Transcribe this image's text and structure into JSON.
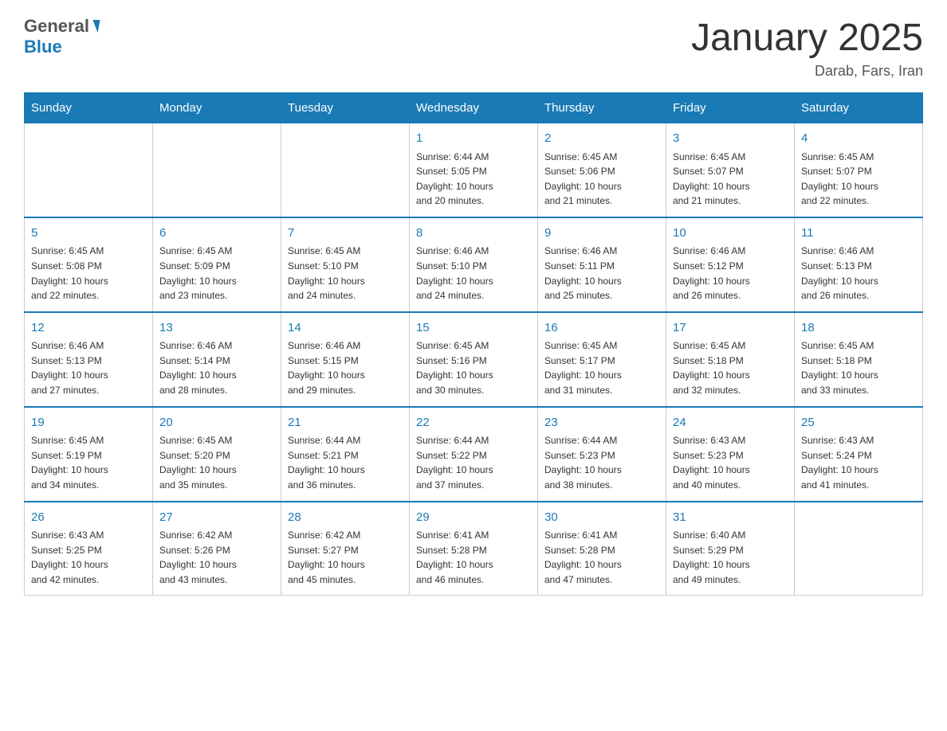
{
  "header": {
    "title": "January 2025",
    "subtitle": "Darab, Fars, Iran",
    "logo_general": "General",
    "logo_blue": "Blue"
  },
  "days_of_week": [
    "Sunday",
    "Monday",
    "Tuesday",
    "Wednesday",
    "Thursday",
    "Friday",
    "Saturday"
  ],
  "weeks": [
    [
      {
        "num": "",
        "info": ""
      },
      {
        "num": "",
        "info": ""
      },
      {
        "num": "",
        "info": ""
      },
      {
        "num": "1",
        "info": "Sunrise: 6:44 AM\nSunset: 5:05 PM\nDaylight: 10 hours\nand 20 minutes."
      },
      {
        "num": "2",
        "info": "Sunrise: 6:45 AM\nSunset: 5:06 PM\nDaylight: 10 hours\nand 21 minutes."
      },
      {
        "num": "3",
        "info": "Sunrise: 6:45 AM\nSunset: 5:07 PM\nDaylight: 10 hours\nand 21 minutes."
      },
      {
        "num": "4",
        "info": "Sunrise: 6:45 AM\nSunset: 5:07 PM\nDaylight: 10 hours\nand 22 minutes."
      }
    ],
    [
      {
        "num": "5",
        "info": "Sunrise: 6:45 AM\nSunset: 5:08 PM\nDaylight: 10 hours\nand 22 minutes."
      },
      {
        "num": "6",
        "info": "Sunrise: 6:45 AM\nSunset: 5:09 PM\nDaylight: 10 hours\nand 23 minutes."
      },
      {
        "num": "7",
        "info": "Sunrise: 6:45 AM\nSunset: 5:10 PM\nDaylight: 10 hours\nand 24 minutes."
      },
      {
        "num": "8",
        "info": "Sunrise: 6:46 AM\nSunset: 5:10 PM\nDaylight: 10 hours\nand 24 minutes."
      },
      {
        "num": "9",
        "info": "Sunrise: 6:46 AM\nSunset: 5:11 PM\nDaylight: 10 hours\nand 25 minutes."
      },
      {
        "num": "10",
        "info": "Sunrise: 6:46 AM\nSunset: 5:12 PM\nDaylight: 10 hours\nand 26 minutes."
      },
      {
        "num": "11",
        "info": "Sunrise: 6:46 AM\nSunset: 5:13 PM\nDaylight: 10 hours\nand 26 minutes."
      }
    ],
    [
      {
        "num": "12",
        "info": "Sunrise: 6:46 AM\nSunset: 5:13 PM\nDaylight: 10 hours\nand 27 minutes."
      },
      {
        "num": "13",
        "info": "Sunrise: 6:46 AM\nSunset: 5:14 PM\nDaylight: 10 hours\nand 28 minutes."
      },
      {
        "num": "14",
        "info": "Sunrise: 6:46 AM\nSunset: 5:15 PM\nDaylight: 10 hours\nand 29 minutes."
      },
      {
        "num": "15",
        "info": "Sunrise: 6:45 AM\nSunset: 5:16 PM\nDaylight: 10 hours\nand 30 minutes."
      },
      {
        "num": "16",
        "info": "Sunrise: 6:45 AM\nSunset: 5:17 PM\nDaylight: 10 hours\nand 31 minutes."
      },
      {
        "num": "17",
        "info": "Sunrise: 6:45 AM\nSunset: 5:18 PM\nDaylight: 10 hours\nand 32 minutes."
      },
      {
        "num": "18",
        "info": "Sunrise: 6:45 AM\nSunset: 5:18 PM\nDaylight: 10 hours\nand 33 minutes."
      }
    ],
    [
      {
        "num": "19",
        "info": "Sunrise: 6:45 AM\nSunset: 5:19 PM\nDaylight: 10 hours\nand 34 minutes."
      },
      {
        "num": "20",
        "info": "Sunrise: 6:45 AM\nSunset: 5:20 PM\nDaylight: 10 hours\nand 35 minutes."
      },
      {
        "num": "21",
        "info": "Sunrise: 6:44 AM\nSunset: 5:21 PM\nDaylight: 10 hours\nand 36 minutes."
      },
      {
        "num": "22",
        "info": "Sunrise: 6:44 AM\nSunset: 5:22 PM\nDaylight: 10 hours\nand 37 minutes."
      },
      {
        "num": "23",
        "info": "Sunrise: 6:44 AM\nSunset: 5:23 PM\nDaylight: 10 hours\nand 38 minutes."
      },
      {
        "num": "24",
        "info": "Sunrise: 6:43 AM\nSunset: 5:23 PM\nDaylight: 10 hours\nand 40 minutes."
      },
      {
        "num": "25",
        "info": "Sunrise: 6:43 AM\nSunset: 5:24 PM\nDaylight: 10 hours\nand 41 minutes."
      }
    ],
    [
      {
        "num": "26",
        "info": "Sunrise: 6:43 AM\nSunset: 5:25 PM\nDaylight: 10 hours\nand 42 minutes."
      },
      {
        "num": "27",
        "info": "Sunrise: 6:42 AM\nSunset: 5:26 PM\nDaylight: 10 hours\nand 43 minutes."
      },
      {
        "num": "28",
        "info": "Sunrise: 6:42 AM\nSunset: 5:27 PM\nDaylight: 10 hours\nand 45 minutes."
      },
      {
        "num": "29",
        "info": "Sunrise: 6:41 AM\nSunset: 5:28 PM\nDaylight: 10 hours\nand 46 minutes."
      },
      {
        "num": "30",
        "info": "Sunrise: 6:41 AM\nSunset: 5:28 PM\nDaylight: 10 hours\nand 47 minutes."
      },
      {
        "num": "31",
        "info": "Sunrise: 6:40 AM\nSunset: 5:29 PM\nDaylight: 10 hours\nand 49 minutes."
      },
      {
        "num": "",
        "info": ""
      }
    ]
  ]
}
